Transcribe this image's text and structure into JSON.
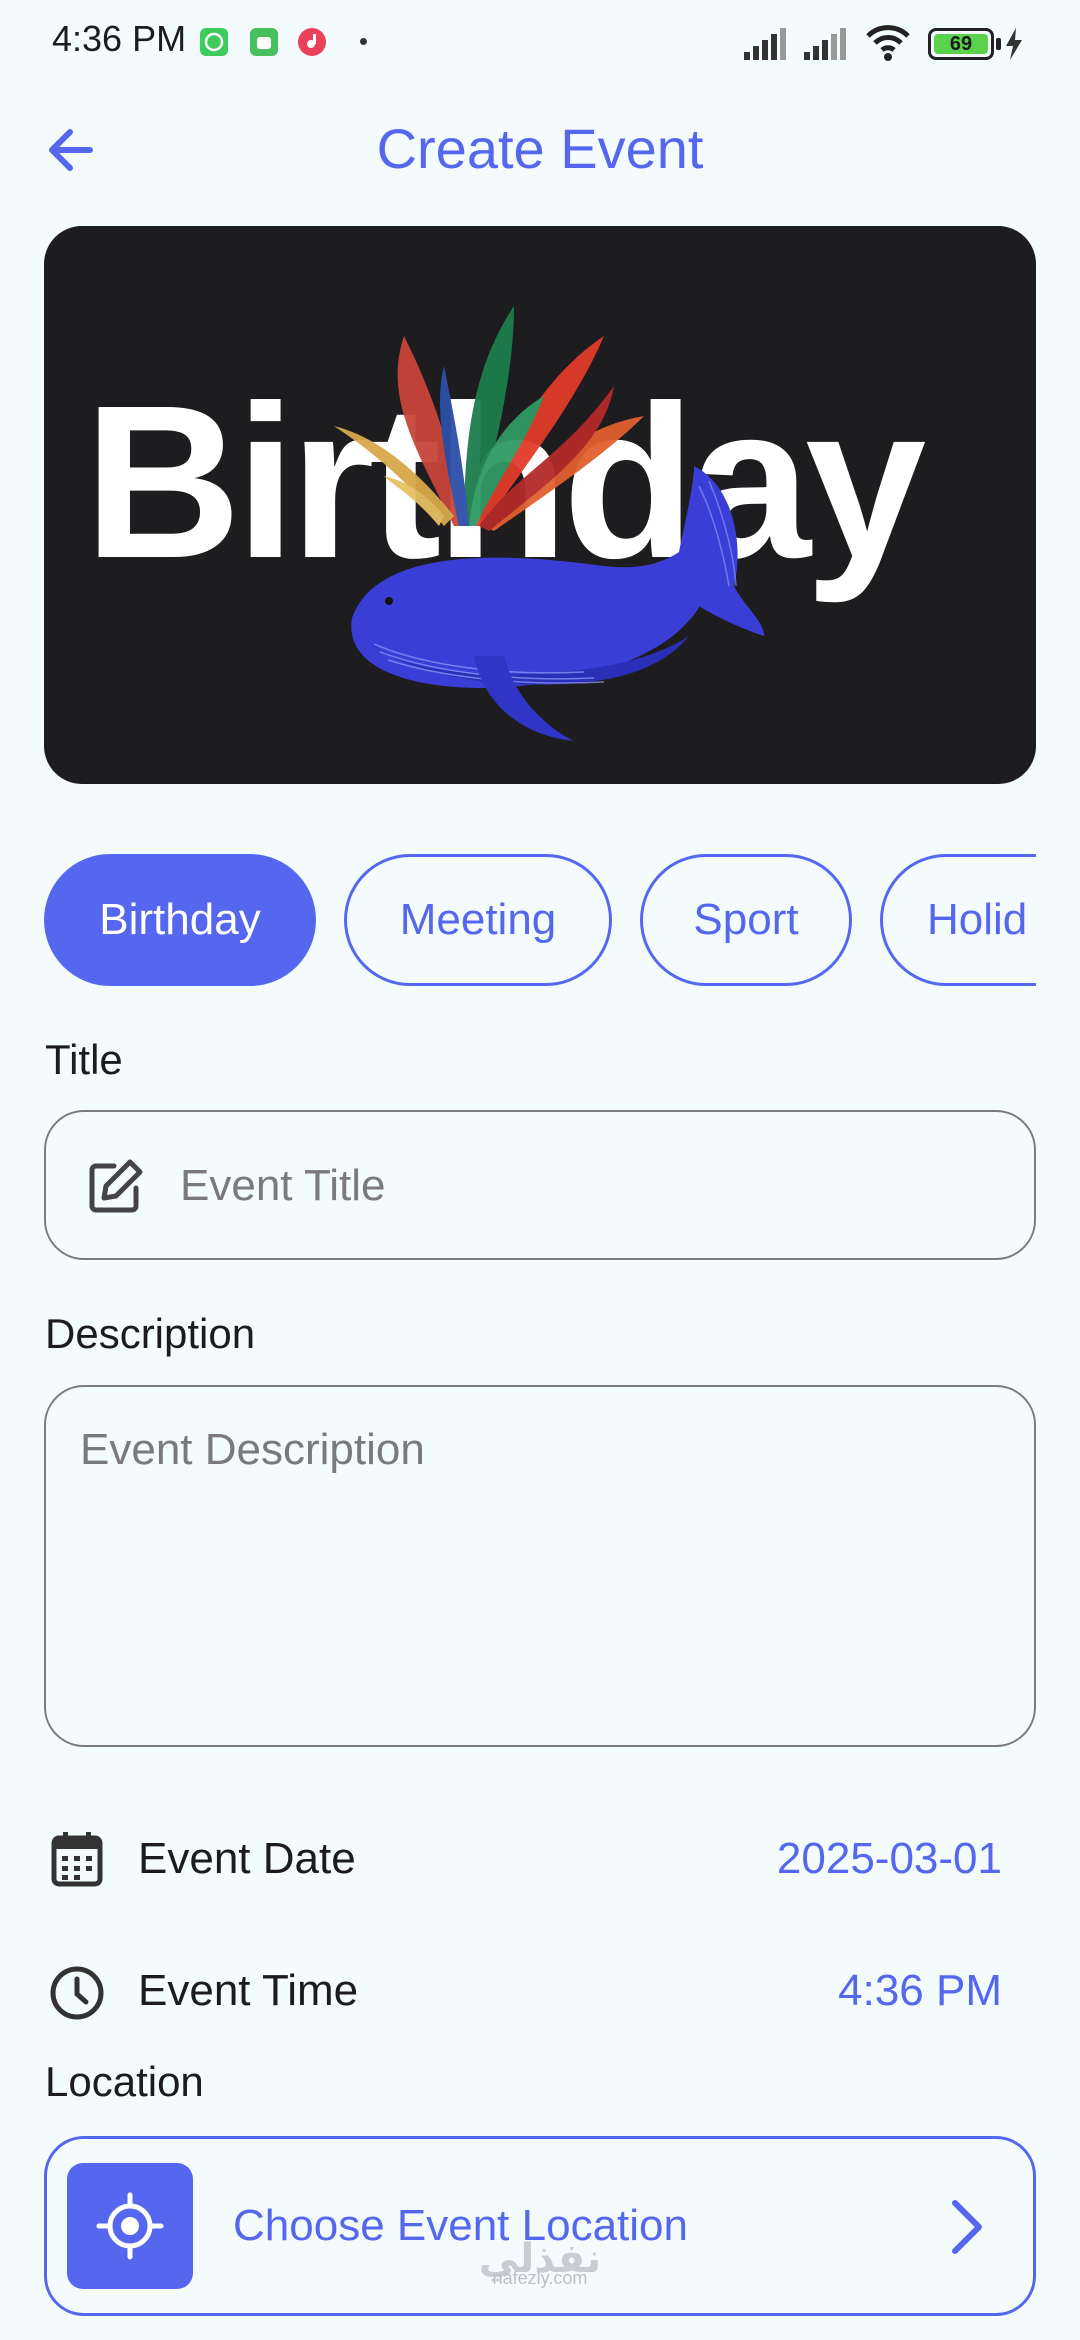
{
  "status_bar": {
    "time": "4:36 PM",
    "battery": "69",
    "icons": [
      "whatsapp-icon",
      "android-icon",
      "music-icon",
      "dot",
      "signal-icon",
      "signal-icon",
      "wifi-icon",
      "battery-icon",
      "charging-icon"
    ]
  },
  "header": {
    "title": "Create Event",
    "back_icon": "arrow-left-icon"
  },
  "banner": {
    "text": "Birthday",
    "illustration": "whale-with-colorful-spray"
  },
  "categories": {
    "items": [
      "Birthday",
      "Meeting",
      "Sport",
      "Holid"
    ],
    "selected": "Birthday"
  },
  "form": {
    "title_label": "Title",
    "title_placeholder": "Event Title",
    "title_icon": "edit-icon",
    "description_label": "Description",
    "description_placeholder": "Event Description",
    "date_label": "Event Date",
    "date_value": "2025-03-01",
    "date_icon": "calendar-icon",
    "time_label": "Event Time",
    "time_value": "4:36 PM",
    "time_icon": "clock-icon",
    "location_label": "Location",
    "location_button": "Choose Event Location",
    "location_icon": "gps-target-icon"
  },
  "watermark": {
    "arabic": "نفذلي",
    "latin": "nafezly.com"
  },
  "colors": {
    "accent": "#5567ee",
    "background": "#f4fbfd",
    "banner_bg": "#1d1c1e"
  }
}
